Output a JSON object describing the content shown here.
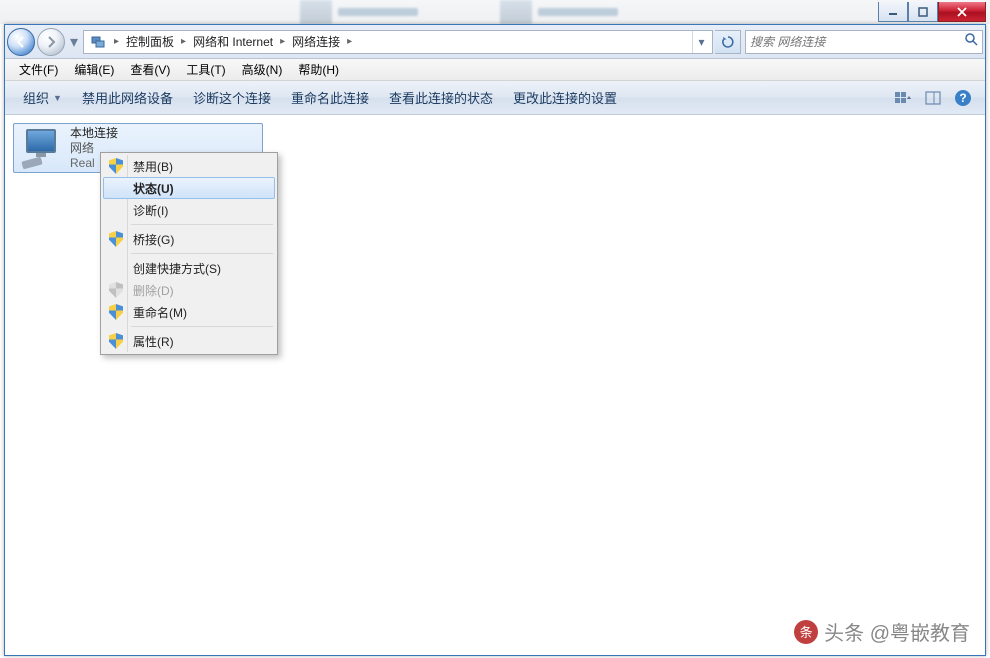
{
  "breadcrumb": {
    "item1": "控制面板",
    "item2": "网络和 Internet",
    "item3": "网络连接"
  },
  "search": {
    "placeholder": "搜索 网络连接"
  },
  "menubar": {
    "file": "文件(F)",
    "edit": "编辑(E)",
    "view": "查看(V)",
    "tools": "工具(T)",
    "advanced": "高级(N)",
    "help": "帮助(H)"
  },
  "toolbar": {
    "organize": "组织",
    "disable": "禁用此网络设备",
    "diagnose": "诊断这个连接",
    "rename": "重命名此连接",
    "status": "查看此连接的状态",
    "change": "更改此连接的设置"
  },
  "network_item": {
    "title": "本地连接",
    "sub1": "网络",
    "sub2": "Real"
  },
  "context_menu": {
    "disable": "禁用(B)",
    "status": "状态(U)",
    "diagnose": "诊断(I)",
    "bridge": "桥接(G)",
    "shortcut": "创建快捷方式(S)",
    "delete": "删除(D)",
    "rename": "重命名(M)",
    "properties": "属性(R)"
  },
  "watermark": "头条 @粤嵌教育"
}
